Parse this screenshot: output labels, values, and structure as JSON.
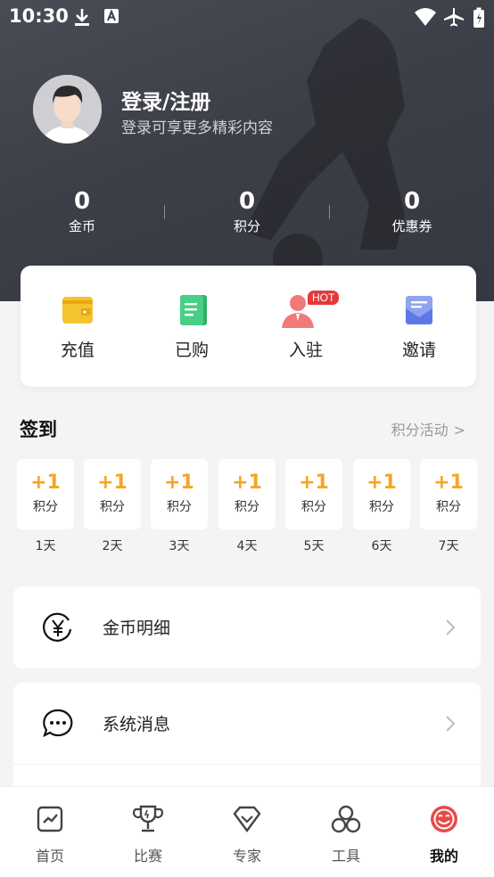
{
  "status_bar": {
    "time": "10:30"
  },
  "profile": {
    "title": "登录/注册",
    "subtitle": "登录可享更多精彩内容"
  },
  "stats": [
    {
      "value": "0",
      "label": "金币"
    },
    {
      "value": "0",
      "label": "积分"
    },
    {
      "value": "0",
      "label": "优惠券"
    }
  ],
  "quick_actions": [
    {
      "label": "充值",
      "icon": "wallet-icon"
    },
    {
      "label": "已购",
      "icon": "document-icon"
    },
    {
      "label": "入驻",
      "icon": "person-icon",
      "badge": "HOT"
    },
    {
      "label": "邀请",
      "icon": "mail-icon"
    }
  ],
  "checkin": {
    "title": "签到",
    "link": "积分活动",
    "days": [
      {
        "plus": "+1",
        "unit": "积分",
        "day": "1天"
      },
      {
        "plus": "+1",
        "unit": "积分",
        "day": "2天"
      },
      {
        "plus": "+1",
        "unit": "积分",
        "day": "3天"
      },
      {
        "plus": "+1",
        "unit": "积分",
        "day": "4天"
      },
      {
        "plus": "+1",
        "unit": "积分",
        "day": "5天"
      },
      {
        "plus": "+1",
        "unit": "积分",
        "day": "6天"
      },
      {
        "plus": "+1",
        "unit": "积分",
        "day": "7天"
      }
    ]
  },
  "menu": [
    {
      "label": "金币明细",
      "icon": "yen-coin-icon"
    },
    {
      "label": "系统消息",
      "icon": "chat-bubble-icon"
    }
  ],
  "tabs": [
    {
      "label": "首页",
      "icon": "chart-icon"
    },
    {
      "label": "比赛",
      "icon": "trophy-icon"
    },
    {
      "label": "专家",
      "icon": "diamond-icon"
    },
    {
      "label": "工具",
      "icon": "circles-icon"
    },
    {
      "label": "我的",
      "icon": "smiley-icon",
      "active": true
    }
  ],
  "colors": {
    "accent": "#e23a3a",
    "gold": "#f5a623",
    "hero": "#40424b"
  }
}
